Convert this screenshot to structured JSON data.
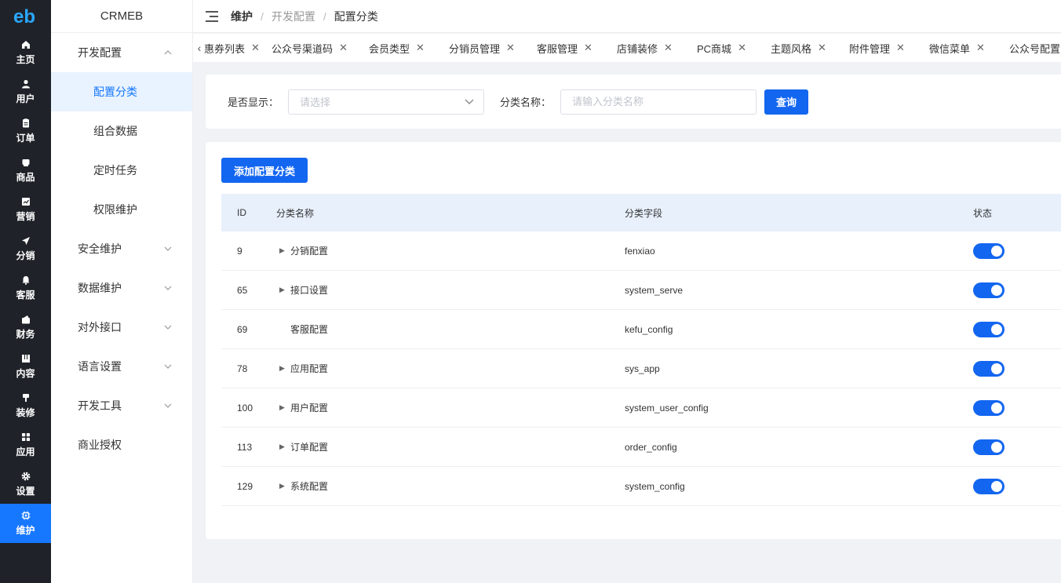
{
  "brand": "CRMEB",
  "accent_color": "#1366f0",
  "iconbar": [
    {
      "label": "主页",
      "icon": "home-icon"
    },
    {
      "label": "用户",
      "icon": "user-icon"
    },
    {
      "label": "订单",
      "icon": "order-icon"
    },
    {
      "label": "商品",
      "icon": "goods-icon"
    },
    {
      "label": "营销",
      "icon": "marketing-icon"
    },
    {
      "label": "分销",
      "icon": "distribution-icon"
    },
    {
      "label": "客服",
      "icon": "service-icon"
    },
    {
      "label": "财务",
      "icon": "finance-icon"
    },
    {
      "label": "内容",
      "icon": "content-icon"
    },
    {
      "label": "装修",
      "icon": "decoration-icon"
    },
    {
      "label": "应用",
      "icon": "apps-icon"
    },
    {
      "label": "设置",
      "icon": "settings-icon"
    },
    {
      "label": "维护",
      "icon": "maintenance-icon",
      "active": true
    }
  ],
  "submenu": [
    {
      "label": "开发配置",
      "type": "group",
      "open": true
    },
    {
      "label": "配置分类",
      "type": "child",
      "active": true
    },
    {
      "label": "组合数据",
      "type": "child"
    },
    {
      "label": "定时任务",
      "type": "child"
    },
    {
      "label": "权限维护",
      "type": "child"
    },
    {
      "label": "安全维护",
      "type": "group"
    },
    {
      "label": "数据维护",
      "type": "group"
    },
    {
      "label": "对外接口",
      "type": "group"
    },
    {
      "label": "语言设置",
      "type": "group"
    },
    {
      "label": "开发工具",
      "type": "group"
    },
    {
      "label": "商业授权",
      "type": "leaf"
    }
  ],
  "breadcrumb": [
    "维护",
    "开发配置",
    "配置分类"
  ],
  "tabs": [
    "惠券列表",
    "公众号渠道码",
    "会员类型",
    "分销员管理",
    "客服管理",
    "店铺装修",
    "PC商城",
    "主题风格",
    "附件管理",
    "微信菜单",
    "公众号配置"
  ],
  "search": {
    "show_label": "是否显示：",
    "show_placeholder": "请选择",
    "name_label": "分类名称：",
    "name_placeholder": "请输入分类名称",
    "query_button": "查询"
  },
  "add_button": "添加配置分类",
  "table": {
    "headers": {
      "id": "ID",
      "name": "分类名称",
      "field": "分类字段",
      "status": "状态"
    },
    "rows": [
      {
        "id": "9",
        "name": "分销配置",
        "field": "fenxiao",
        "expandable": true,
        "status": true
      },
      {
        "id": "65",
        "name": "接口设置",
        "field": "system_serve",
        "expandable": true,
        "status": true
      },
      {
        "id": "69",
        "name": "客服配置",
        "field": "kefu_config",
        "expandable": false,
        "status": true
      },
      {
        "id": "78",
        "name": "应用配置",
        "field": "sys_app",
        "expandable": true,
        "status": true
      },
      {
        "id": "100",
        "name": "用户配置",
        "field": "system_user_config",
        "expandable": true,
        "status": true
      },
      {
        "id": "113",
        "name": "订单配置",
        "field": "order_config",
        "expandable": true,
        "status": true
      },
      {
        "id": "129",
        "name": "系统配置",
        "field": "system_config",
        "expandable": true,
        "status": true
      }
    ]
  }
}
